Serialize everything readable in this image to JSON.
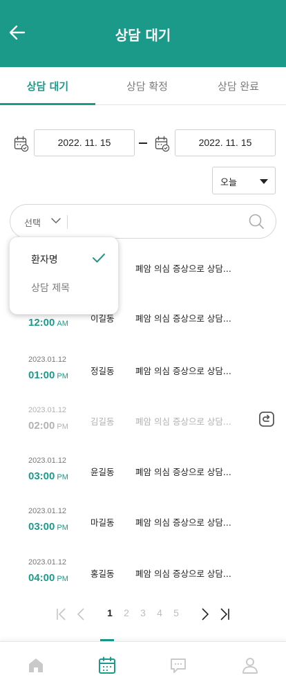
{
  "header": {
    "title": "상담 대기",
    "back_icon": "arrow-left-icon"
  },
  "tabs": [
    {
      "label": "상담 대기",
      "active": true
    },
    {
      "label": "상담 확정",
      "active": false
    },
    {
      "label": "상담 완료",
      "active": false
    }
  ],
  "date_range": {
    "start": "2022. 11. 15",
    "end": "2022. 11. 15",
    "calendar_icon": "calendar-icon"
  },
  "period_select": {
    "value": "오늘"
  },
  "search": {
    "type_label": "선택",
    "icon": "search-icon"
  },
  "search_type_menu": {
    "options": [
      {
        "label": "환자명",
        "selected": true
      },
      {
        "label": "상담 제목",
        "selected": false
      }
    ]
  },
  "appointments": [
    {
      "date": "",
      "time": "",
      "ampm": "",
      "name": "",
      "subject": "폐암 의심 증상으로 상담..."
    },
    {
      "date": "",
      "time": "12:00",
      "ampm": "AM",
      "name": "이길동",
      "subject": "폐암 의심 증상으로 상담..."
    },
    {
      "date": "2023.01.12",
      "time": "01:00",
      "ampm": "PM",
      "name": "정길동",
      "subject": "폐암 의심 증상으로 상담..."
    },
    {
      "date": "2023.01.12",
      "time": "02:00",
      "ampm": "PM",
      "name": "김길동",
      "subject": "폐암 의심 증상으로 상담...",
      "disabled": true,
      "action_icon": "reschedule-icon"
    },
    {
      "date": "2023.01.12",
      "time": "03:00",
      "ampm": "PM",
      "name": "윤길동",
      "subject": "폐암 의심 증상으로 상담..."
    },
    {
      "date": "2023.01.12",
      "time": "03:00",
      "ampm": "PM",
      "name": "마길동",
      "subject": "폐암 의심 증상으로 상담..."
    },
    {
      "date": "2023.01.12",
      "time": "04:00",
      "ampm": "PM",
      "name": "홍길동",
      "subject": "폐암 의심 증상으로 상담..."
    }
  ],
  "pagination": {
    "pages": [
      "1",
      "2",
      "3",
      "4",
      "5"
    ],
    "current": "1"
  },
  "bottom_nav": {
    "items": [
      {
        "icon": "home-icon",
        "active": false
      },
      {
        "icon": "calendar-icon",
        "active": true
      },
      {
        "icon": "chat-icon",
        "active": false
      },
      {
        "icon": "user-icon",
        "active": false
      }
    ]
  },
  "colors": {
    "primary": "#1b9a8a",
    "text": "#222222",
    "muted": "#b2b2b2"
  }
}
